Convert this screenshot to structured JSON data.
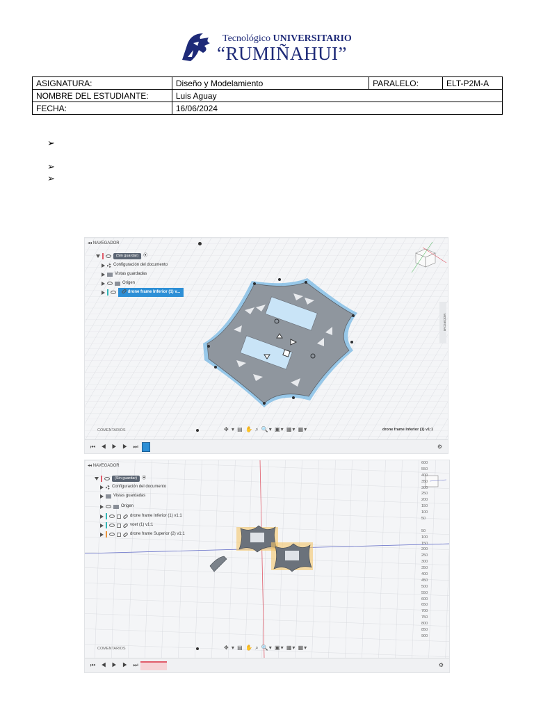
{
  "header": {
    "institution_prefix": "Tecnológico",
    "institution_type": "UNIVERSITARIO",
    "institution_name": "“RUMIÑAHUI”",
    "logo_icon": "rumiñahui-head-logo"
  },
  "info_table": {
    "rows": [
      {
        "label": "ASIGNATURA:",
        "value": "Diseño y Modelamiento",
        "label2": "PARALELO",
        "sep": ":",
        "value2": "ELT-P2M-A"
      },
      {
        "label": "NOMBRE DEL ESTUDIANTE:",
        "value": "Luis Aguay"
      },
      {
        "label": "FECHA:",
        "value": "16/06/2024"
      }
    ]
  },
  "bullets": [
    "➢",
    "➢",
    "➢"
  ],
  "screenshot1": {
    "navigator_title": "NAVEGADOR",
    "root": "(Sin guardar)",
    "items": [
      "Configuración del documento",
      "Vistas guardadas",
      "Origen",
      "drone frame Inferior (1) v..."
    ],
    "comments": "COMENTARIOS",
    "side_tab": "MODIFICAR",
    "status_label": "drone frame Inferior (1) v1:1"
  },
  "screenshot2": {
    "navigator_title": "NAVEGADOR",
    "root": "(Sin guardar)",
    "items": [
      "Configuración del documento",
      "Vistas guardadas",
      "Origen",
      "drone frame Inferior (1) v1:1",
      "voet (1) v1:1",
      "drone frame Superior (2) v1:1"
    ],
    "comments": "COMENTARIOS",
    "ruler": [
      "600",
      "550",
      "400",
      "350",
      "300",
      "250",
      "200",
      "150",
      "100",
      "50",
      "",
      "50",
      "100",
      "150",
      "200",
      "250",
      "300",
      "350",
      "400",
      "450",
      "500",
      "550",
      "600",
      "650",
      "700",
      "750",
      "800",
      "850",
      "900"
    ]
  },
  "icons": {
    "timeline_controls": "⏮ ◀ ▶ ▶ ⏭",
    "toolbar": "✥ ▾ ▤ ✋ ⌕ 🔍▾ ▣▾ ▦▾ ▦▾",
    "settings": "⚙"
  },
  "colors": {
    "brand_blue": "#1e2a78",
    "selection_blue": "#2d8fd6",
    "frame_gray": "#8f969e",
    "frame_edge": "#4aa3df"
  }
}
